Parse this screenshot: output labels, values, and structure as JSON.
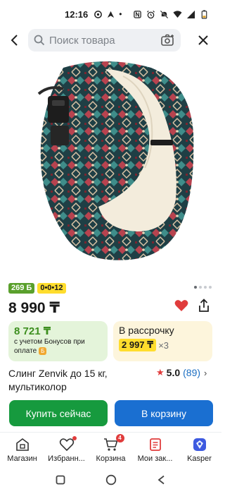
{
  "status": {
    "time": "12:16"
  },
  "search": {
    "placeholder": "Поиск товара"
  },
  "badges": {
    "cashback": "269 Б",
    "installment_plan": "0•0•12"
  },
  "product": {
    "price": "8 990 ₸",
    "title": "Слинг Zenvik до 15 кг, мультиколор",
    "rating": "5.0",
    "reviews": "(89)"
  },
  "bonus": {
    "price": "8 721 ₸",
    "note": "с учетом Бонусов при оплате"
  },
  "installment": {
    "title": "В рассрочку",
    "amount": "2 997 ₸",
    "times": "×3"
  },
  "actions": {
    "buy": "Купить сейчас",
    "cart": "В корзину"
  },
  "tabs": [
    {
      "label": "Магазин"
    },
    {
      "label": "Избранн..."
    },
    {
      "label": "Корзина",
      "badge": "4"
    },
    {
      "label": "Мои зак..."
    },
    {
      "label": "Kasper"
    }
  ],
  "colors": {
    "accent_green": "#169a3e",
    "accent_blue": "#1a6fd1",
    "bonus_green": "#3d8f1f",
    "highlight_yellow": "#ffdd2d",
    "heart_red": "#e03c3c"
  }
}
